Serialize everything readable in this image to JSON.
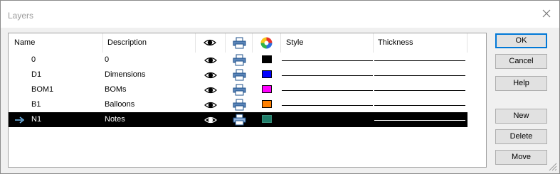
{
  "window": {
    "title": "Layers"
  },
  "columns": {
    "name": "Name",
    "description": "Description",
    "style": "Style",
    "thickness": "Thickness"
  },
  "header_icons": [
    "eye-icon",
    "printer-icon",
    "color-wheel-icon"
  ],
  "rows": [
    {
      "name": "0",
      "description": "0",
      "color": "#000000",
      "visible": true,
      "printable": true,
      "selected": false,
      "has_style_line": true
    },
    {
      "name": "D1",
      "description": "Dimensions",
      "color": "#0000ff",
      "visible": true,
      "printable": true,
      "selected": false,
      "has_style_line": true
    },
    {
      "name": "BOM1",
      "description": "BOMs",
      "color": "#ff00ff",
      "visible": true,
      "printable": true,
      "selected": false,
      "has_style_line": true
    },
    {
      "name": "B1",
      "description": "Balloons",
      "color": "#ff8000",
      "visible": true,
      "printable": true,
      "selected": false,
      "has_style_line": true
    },
    {
      "name": "N1",
      "description": "Notes",
      "color": "#1e7d6a",
      "visible": true,
      "printable": true,
      "selected": true,
      "has_style_line": false,
      "current_marker": "arrow-right-icon"
    }
  ],
  "buttons": {
    "ok": "OK",
    "cancel": "Cancel",
    "help": "Help",
    "new": "New",
    "delete": "Delete",
    "move": "Move"
  }
}
